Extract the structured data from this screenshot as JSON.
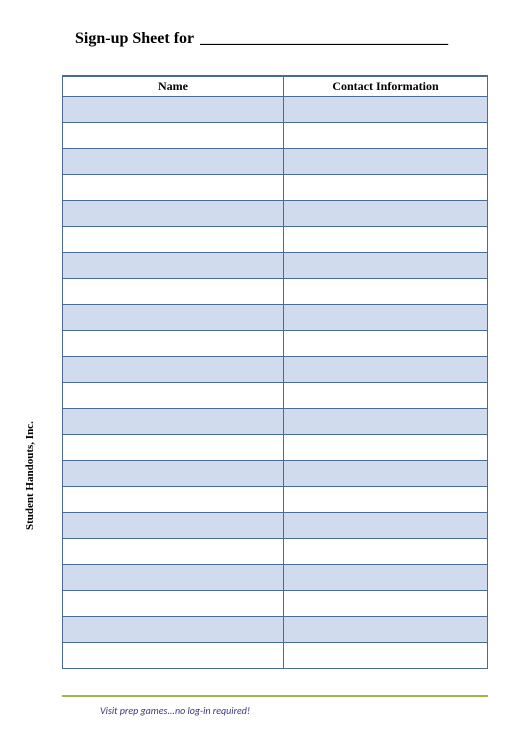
{
  "title": {
    "prefix": "Sign-up Sheet for",
    "blank": "_______________________________"
  },
  "table": {
    "headers": {
      "name": "Name",
      "contact": "Contact Information"
    },
    "rows": [
      {
        "name": "",
        "contact": ""
      },
      {
        "name": "",
        "contact": ""
      },
      {
        "name": "",
        "contact": ""
      },
      {
        "name": "",
        "contact": ""
      },
      {
        "name": "",
        "contact": ""
      },
      {
        "name": "",
        "contact": ""
      },
      {
        "name": "",
        "contact": ""
      },
      {
        "name": "",
        "contact": ""
      },
      {
        "name": "",
        "contact": ""
      },
      {
        "name": "",
        "contact": ""
      },
      {
        "name": "",
        "contact": ""
      },
      {
        "name": "",
        "contact": ""
      },
      {
        "name": "",
        "contact": ""
      },
      {
        "name": "",
        "contact": ""
      },
      {
        "name": "",
        "contact": ""
      },
      {
        "name": "",
        "contact": ""
      },
      {
        "name": "",
        "contact": ""
      },
      {
        "name": "",
        "contact": ""
      },
      {
        "name": "",
        "contact": ""
      },
      {
        "name": "",
        "contact": ""
      },
      {
        "name": "",
        "contact": ""
      },
      {
        "name": "",
        "contact": ""
      }
    ]
  },
  "side_label": "Student Handouts, Inc.",
  "footer": "Visit  prep games...no log-in required!"
}
